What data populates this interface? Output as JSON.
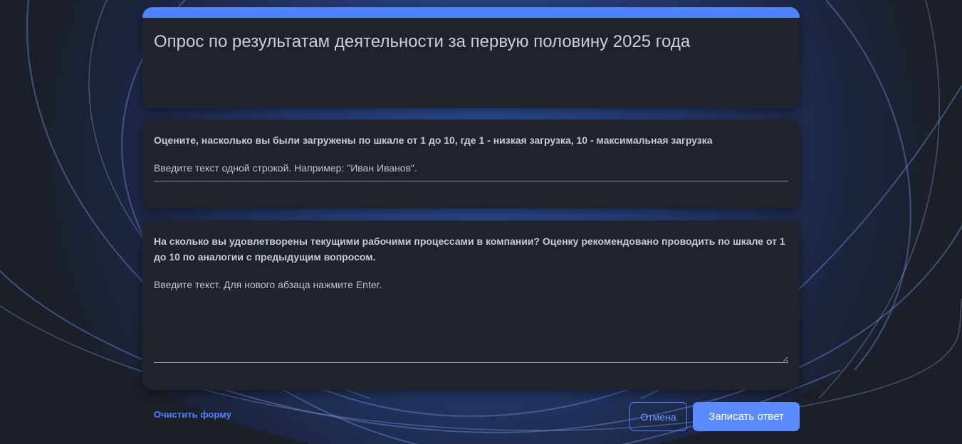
{
  "theme": {
    "accent": "#4f82ff",
    "card_background": "#1f232c",
    "page_background": "#1b1f28"
  },
  "form": {
    "title": "Опрос по результатам деятельности за первую половину 2025 года"
  },
  "questions": [
    {
      "label": "Оцените, насколько вы были загружены по шкале от 1 до 10, где 1 - низкая загрузка, 10 - максимальная загрузка",
      "type": "short-text",
      "value": "",
      "placeholder": "Введите текст одной строкой. Например: \"Иван Иванов\"."
    },
    {
      "label": "На сколько вы удовлетворены текущими рабочими процессами в компании? Оценку рекомендовано проводить по шкале от 1 до 10 по аналогии с предыдущим вопросом.",
      "type": "paragraph",
      "value": "",
      "placeholder": "Введите текст. Для нового абзаца нажмите Enter."
    }
  ],
  "actions": {
    "clear_label": "Очистить форму",
    "cancel_label": "Отмена",
    "submit_label": "Записать ответ"
  }
}
